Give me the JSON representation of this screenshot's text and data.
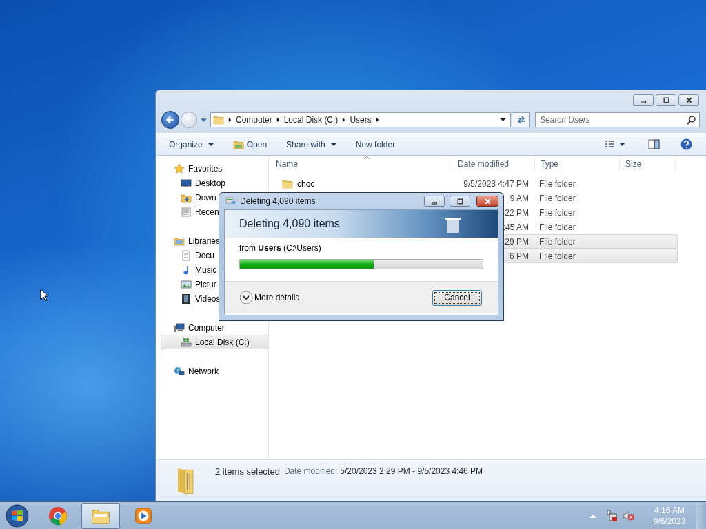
{
  "explorer": {
    "address_path": [
      "Computer",
      "Local Disk (C:)",
      "Users"
    ],
    "search": {
      "placeholder": "Search Users"
    },
    "toolbar": [
      {
        "label": "Organize",
        "kind": "menu"
      },
      {
        "label": "Open",
        "kind": "open"
      },
      {
        "label": "Share with",
        "kind": "menu"
      },
      {
        "label": "New folder",
        "kind": "plain"
      }
    ],
    "nav": [
      {
        "label": "Favorites",
        "kind": "star",
        "selected": false,
        "children": [
          {
            "label": "Desktop",
            "kind": "desktop",
            "selected": false
          },
          {
            "label": "Down",
            "kind": "download",
            "selected": false
          },
          {
            "label": "Recen",
            "kind": "recent",
            "selected": false
          }
        ]
      },
      {
        "label": "Libraries",
        "kind": "library",
        "selected": false,
        "children": [
          {
            "label": "Docu",
            "kind": "document",
            "selected": false
          },
          {
            "label": "Music",
            "kind": "music",
            "selected": false
          },
          {
            "label": "Pictur",
            "kind": "picture",
            "selected": false
          },
          {
            "label": "Videos",
            "kind": "video",
            "selected": false
          }
        ]
      },
      {
        "label": "Computer",
        "kind": "computer",
        "selected": false,
        "children": [
          {
            "label": "Local Disk (C:)",
            "kind": "disk",
            "selected": true
          }
        ]
      },
      {
        "label": "Network",
        "kind": "network",
        "selected": false
      }
    ],
    "columns": [
      "Name",
      "Date modified",
      "Type",
      "Size"
    ],
    "rows": [
      {
        "name": "choc",
        "date_modified": "9/5/2023 4:47 PM",
        "type": "File folder",
        "selected": false
      },
      {
        "date_modified": "9 AM",
        "type": "File folder",
        "selected": false
      },
      {
        "date_modified": ":22 PM",
        "type": "File folder",
        "selected": false
      },
      {
        "date_modified": ":45 AM",
        "type": "File folder",
        "selected": false
      },
      {
        "date_modified": ":29 PM",
        "type": "File folder",
        "selected": true
      },
      {
        "date_modified": "6 PM",
        "type": "File folder",
        "selected": true
      }
    ],
    "status": {
      "count": "2 items selected",
      "label": "Date modified:",
      "value": "5/20/2023 2:29 PM - 9/5/2023 4:46 PM"
    }
  },
  "dialog": {
    "title": "Deleting 4,090 items",
    "heading": "Deleting 4,090 items",
    "source": "from **Users** (C:\\Users)",
    "level": 0.55,
    "details": "More details",
    "cancel": "Cancel"
  },
  "taskbar": {
    "apps": [
      {
        "kind": "browser",
        "active": false
      },
      {
        "kind": "folder",
        "active": true
      },
      {
        "kind": "media",
        "active": false
      }
    ],
    "clock": {
      "time": "4:16 AM",
      "date": "9/6/2023"
    }
  }
}
